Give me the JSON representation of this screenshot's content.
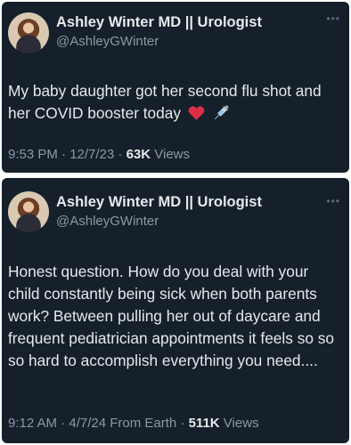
{
  "tweets": [
    {
      "author": {
        "display_name": "Ashley Winter MD || Urologist",
        "handle": "@AshleyGWinter"
      },
      "text": "My baby daughter got her second flu shot and her COVID booster today",
      "emojis": [
        "red-heart",
        "syringe"
      ],
      "time": "9:53 PM · 12/7/23 · ",
      "views_count": "63K",
      "views_label": " Views"
    },
    {
      "author": {
        "display_name": "Ashley Winter MD || Urologist",
        "handle": "@AshleyGWinter"
      },
      "text": "Honest question. How do you deal with your child constantly being sick when both parents work? Between pulling her out of daycare and frequent pediatrician appointments it feels so so so hard to accomplish everything you need....",
      "time": "9:12 AM · 4/7/24 From Earth · ",
      "views_count": "511K",
      "views_label": " Views"
    }
  ],
  "colors": {
    "background": "#15202b",
    "text_primary": "#e7e9ea",
    "text_secondary": "#8b98a5"
  }
}
